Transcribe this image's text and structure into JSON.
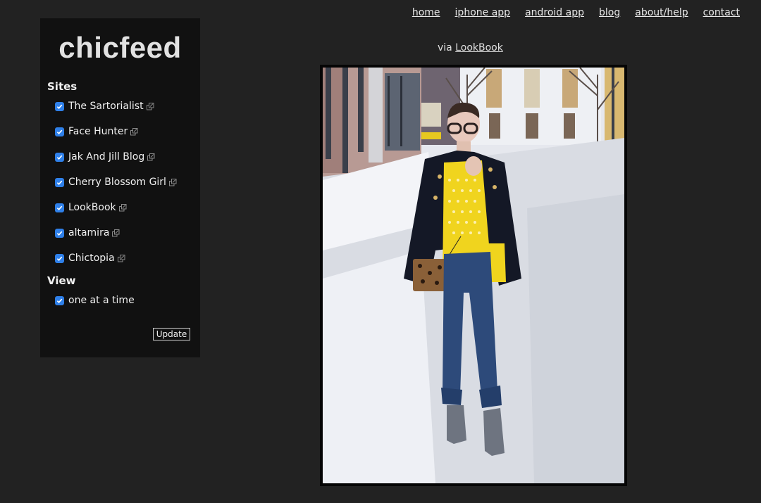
{
  "topnav": {
    "links": [
      "home",
      "iphone app",
      "android app",
      "blog",
      "about/help",
      "contact"
    ]
  },
  "sidebar": {
    "logo": "chicfeed",
    "sites_heading": "Sites",
    "sites": [
      {
        "label": "The Sartorialist",
        "checked": true,
        "icon": "external-link-icon"
      },
      {
        "label": "Face Hunter",
        "checked": true,
        "icon": "external-link-icon"
      },
      {
        "label": "Jak And Jill Blog",
        "checked": true,
        "icon": "external-link-icon"
      },
      {
        "label": "Cherry Blossom Girl",
        "checked": true,
        "icon": "external-link-icon"
      },
      {
        "label": "LookBook",
        "checked": true,
        "icon": "external-link-icon"
      },
      {
        "label": "altamira",
        "checked": true,
        "icon": "external-link-icon"
      },
      {
        "label": "Chictopia",
        "checked": true,
        "icon": "external-link-icon"
      }
    ],
    "view_heading": "View",
    "view_options": [
      {
        "label": "one at a time",
        "checked": true
      }
    ],
    "update_label": "Update"
  },
  "main": {
    "via_prefix": "via",
    "via_source": "LookBook",
    "photo_alt": "Street style photo: woman in yellow polka-dot sweater, black military jacket, blue cropped flare jeans and grey ankle boots on a snowy street"
  },
  "colors": {
    "background": "#222222",
    "sidebar": "#111111",
    "checkbox": "#2f80e9"
  }
}
